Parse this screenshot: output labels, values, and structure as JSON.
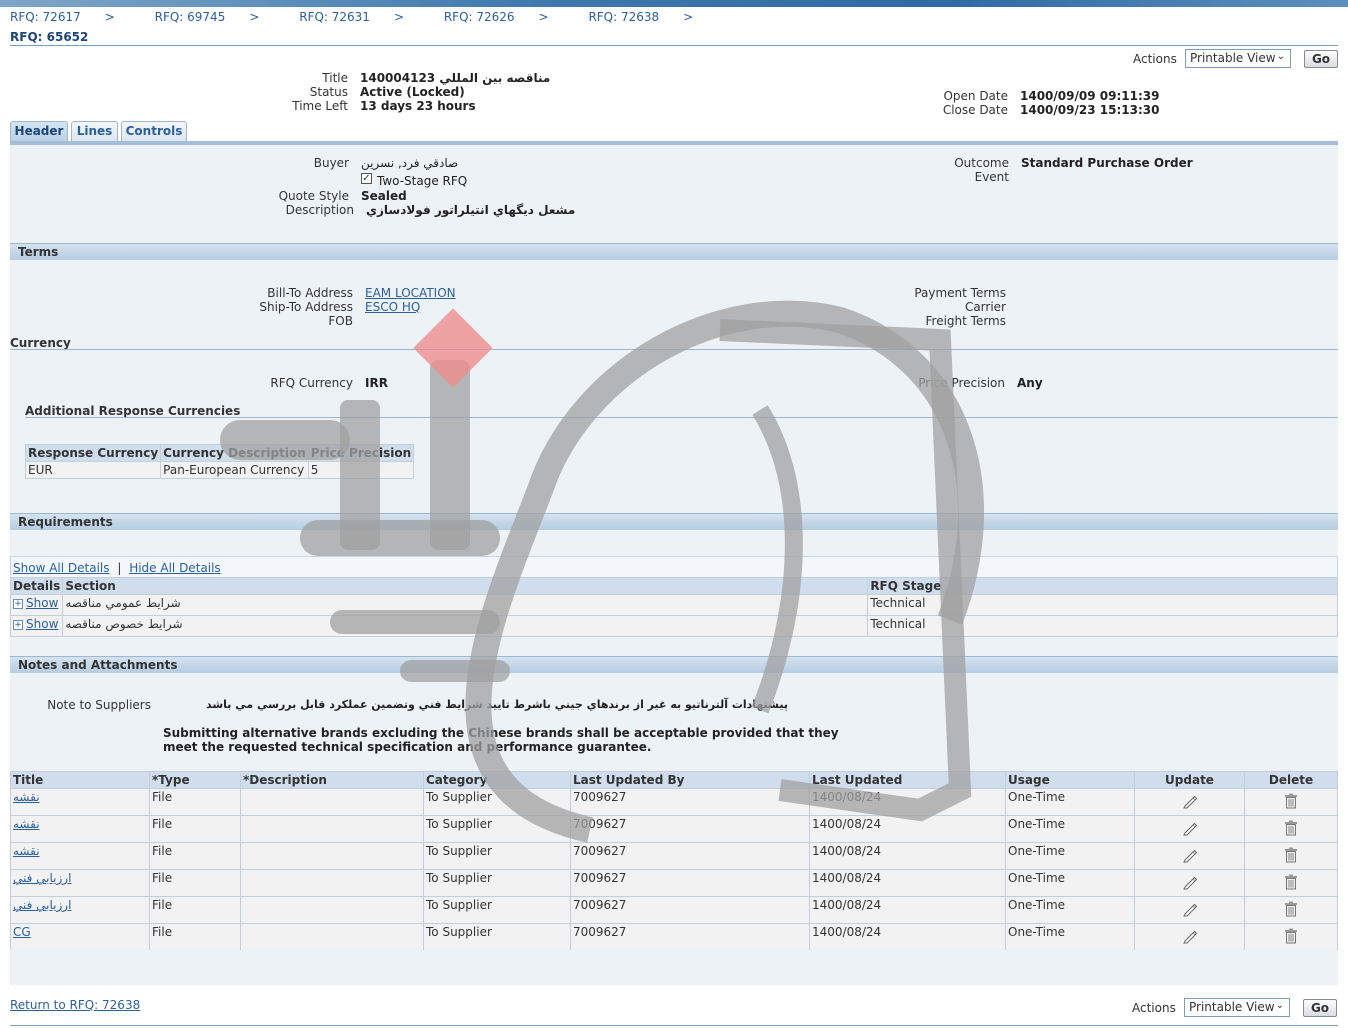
{
  "breadcrumbs": [
    "RFQ: 72617",
    "RFQ: 69745",
    "RFQ: 72631",
    "RFQ: 72626",
    "RFQ: 72638"
  ],
  "crumb_sep": ">",
  "page_title": "RFQ: 65652",
  "actions": {
    "label": "Actions",
    "selected": "Printable View",
    "go": "Go"
  },
  "summary": {
    "title_label": "Title",
    "title_value": "مناقصه بين المللي 140004123",
    "status_label": "Status",
    "status_value": "Active (Locked)",
    "timeleft_label": "Time Left",
    "timeleft_value": "13 days 23 hours",
    "open_label": "Open Date",
    "open_value": "1400/09/09 09:11:39",
    "close_label": "Close Date",
    "close_value": "1400/09/23 15:13:30"
  },
  "tabs": [
    "Header",
    "Lines",
    "Controls"
  ],
  "header": {
    "buyer_label": "Buyer",
    "buyer_value": "صادقي فرد, نسرين",
    "two_stage_label": "Two-Stage RFQ",
    "quote_style_label": "Quote Style",
    "quote_style_value": "Sealed",
    "description_label": "Description",
    "description_value": "مشعل ديگهاي انتيلراتور فولادسازي",
    "outcome_label": "Outcome",
    "outcome_value": "Standard Purchase Order",
    "event_label": "Event"
  },
  "terms": {
    "title": "Terms",
    "bill_to_label": "Bill-To Address",
    "bill_to_value": "EAM LOCATION",
    "ship_to_label": "Ship-To Address",
    "ship_to_value": "ESCO HQ",
    "fob_label": "FOB",
    "payment_terms_label": "Payment Terms",
    "carrier_label": "Carrier",
    "freight_terms_label": "Freight Terms"
  },
  "currency": {
    "title": "Currency",
    "rfq_currency_label": "RFQ Currency",
    "rfq_currency_value": "IRR",
    "price_precision_label": "Price Precision",
    "price_precision_value": "Any",
    "additional_title": "Additional Response Currencies",
    "columns": [
      "Response Currency",
      "Currency Description",
      "Price Precision"
    ],
    "rows": [
      [
        "EUR",
        "Pan-European Currency",
        "5"
      ]
    ]
  },
  "requirements": {
    "title": "Requirements",
    "show_all": "Show All Details",
    "hide_all": "Hide All Details",
    "columns": [
      "Details",
      "Section",
      "RFQ Stage"
    ],
    "rows": [
      {
        "details": "Show",
        "section": "شرايط عمومي مناقصه",
        "stage": "Technical"
      },
      {
        "details": "Show",
        "section": "شرايط خصوص مناقصه",
        "stage": "Technical"
      }
    ]
  },
  "notes": {
    "title": "Notes and Attachments",
    "note_label": "Note to Suppliers",
    "note_fa": "پيشنهادات آلترناتيو به غير  از برندهاي جيني باشرط تاييد شرايط فني وتضمين عملكرد  قابل بررسي مي باشد",
    "note_en_1": "Submitting alternative brands excluding the Chinese brands shall be acceptable provided that they",
    "note_en_2": "meet the requested technical specification and performance guarantee.",
    "columns": [
      "Title",
      "*Type",
      "*Description",
      "Category",
      "Last Updated By",
      "Last Updated",
      "Usage",
      "Update",
      "Delete"
    ],
    "rows": [
      {
        "title": "نقشه",
        "type": "File",
        "description": "",
        "category": "To Supplier",
        "by": "7009627",
        "updated": "1400/08/24",
        "usage": "One-Time"
      },
      {
        "title": "نقشه",
        "type": "File",
        "description": "",
        "category": "To Supplier",
        "by": "7009627",
        "updated": "1400/08/24",
        "usage": "One-Time"
      },
      {
        "title": "نقشه",
        "type": "File",
        "description": "",
        "category": "To Supplier",
        "by": "7009627",
        "updated": "1400/08/24",
        "usage": "One-Time"
      },
      {
        "title": "ارزيابي فني",
        "type": "File",
        "description": "",
        "category": "To Supplier",
        "by": "7009627",
        "updated": "1400/08/24",
        "usage": "One-Time"
      },
      {
        "title": "ارزيابي فني",
        "type": "File",
        "description": "",
        "category": "To Supplier",
        "by": "7009627",
        "updated": "1400/08/24",
        "usage": "One-Time"
      },
      {
        "title": "CG",
        "type": "File",
        "description": "",
        "category": "To Supplier",
        "by": "7009627",
        "updated": "1400/08/24",
        "usage": "One-Time"
      }
    ]
  },
  "footer": {
    "return_link": "Return to RFQ: 72638"
  },
  "icons": {
    "update": "pencil-icon",
    "delete": "trash-icon",
    "expand": "plus-box-icon",
    "checkbox": "checkbox-checked-icon"
  },
  "colors": {
    "link": "#2b5f9e",
    "section_header": "#b6cce2",
    "panel_bg": "#edf2f7",
    "watermark": "#a0a0a0",
    "watermark_accent": "#ef8d8d"
  }
}
